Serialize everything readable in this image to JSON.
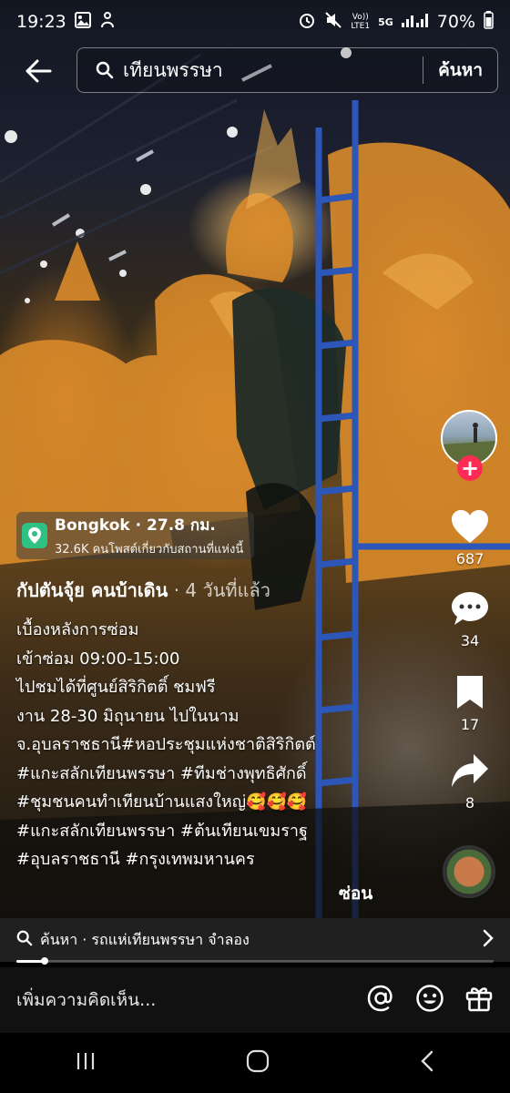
{
  "status_bar": {
    "time": "19:23",
    "network_label": "Vo))\nLTE1",
    "network_type": "5G",
    "battery": "70%"
  },
  "search": {
    "query": "เทียนพรรษา",
    "submit_label": "ค้นหา"
  },
  "rail": {
    "likes": "687",
    "comments": "34",
    "saves": "17",
    "shares": "8"
  },
  "location": {
    "name": "Bongkok",
    "distance": "· 27.8 กม.",
    "posts": "32.6K คนโพสต์เกี่ยวกับสถานที่แห่งนี้"
  },
  "author": {
    "name": "กัปตันจุ้ย คนบ้าเดิน",
    "meta": " · 4 วันที่แล้ว"
  },
  "caption": {
    "lines": [
      "เบื้องหลังการซ่อม",
      "เข้าซ่อม 09:00-15:00",
      "ไปชมได้ที่ศูนย์สิริกิตติ์ ชมฟรี",
      "งาน 28-30 มิถุนายน ไปในนาม",
      "จ.อุบลราชธานี#หอประชุมแห่งชาติสิริกิตต์",
      "#แกะสลักเทียนพรรษา #ทีมช่างพุทธิศักดิ์",
      "#ชุมชนคนทำเทียนบ้านแสงใหญ่🥰🥰🥰",
      "#แกะสลักเทียนพรรษา #ต้นเทียนเขมราฐ",
      "#อุบลราชธานี #กรุงเทพมหานคร"
    ],
    "hide_label": "ซ่อน"
  },
  "related_search": {
    "text": "ค้นหา · รถแห่เทียนพรรษา จำลอง"
  },
  "video_progress": 0.06,
  "comment": {
    "placeholder": "เพิ่มความคิดเห็น..."
  },
  "colors": {
    "follow": "#fe2c55",
    "location_icon": "#2ec184"
  }
}
